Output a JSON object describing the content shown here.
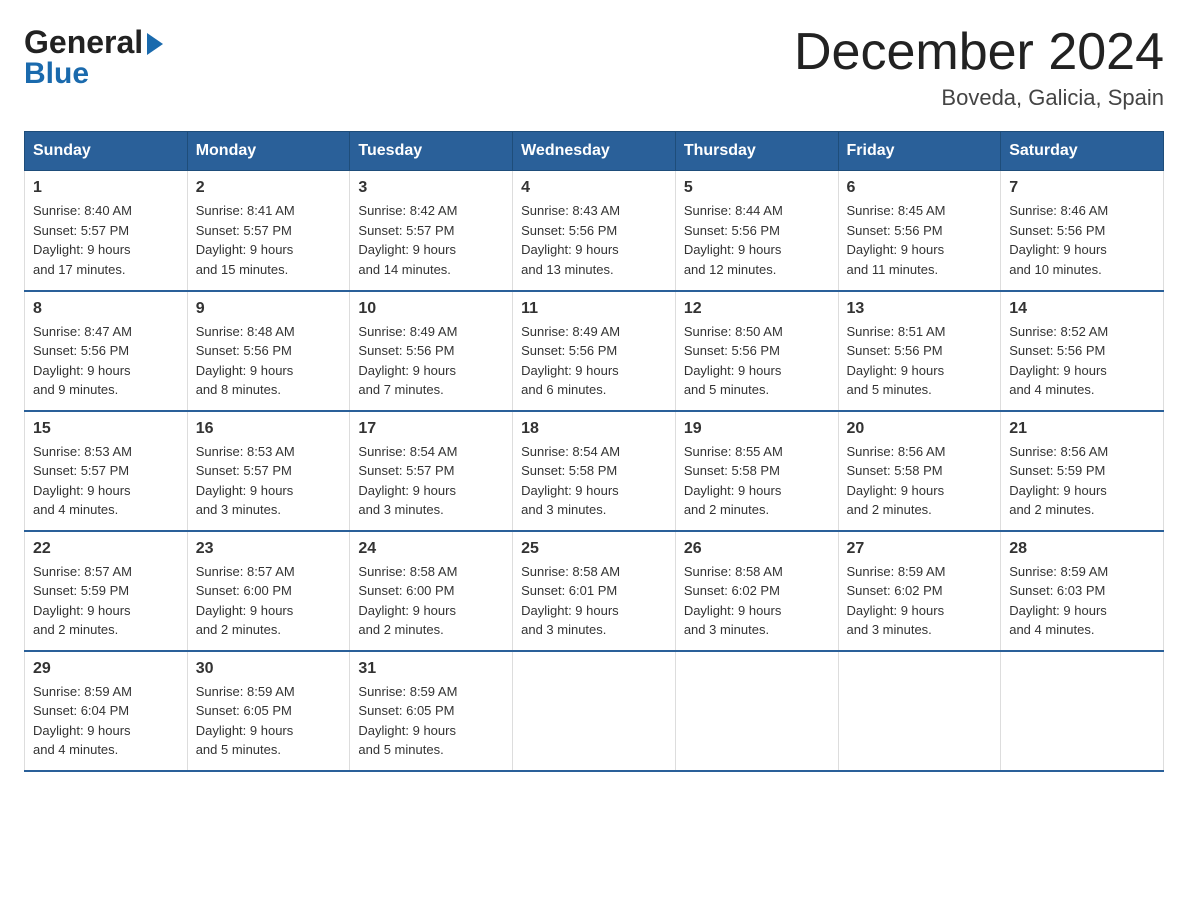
{
  "header": {
    "logo_line1": "General",
    "logo_line2": "Blue",
    "title": "December 2024",
    "location": "Boveda, Galicia, Spain"
  },
  "columns": [
    "Sunday",
    "Monday",
    "Tuesday",
    "Wednesday",
    "Thursday",
    "Friday",
    "Saturday"
  ],
  "weeks": [
    [
      {
        "day": "1",
        "sunrise": "8:40 AM",
        "sunset": "5:57 PM",
        "daylight": "9 hours and 17 minutes."
      },
      {
        "day": "2",
        "sunrise": "8:41 AM",
        "sunset": "5:57 PM",
        "daylight": "9 hours and 15 minutes."
      },
      {
        "day": "3",
        "sunrise": "8:42 AM",
        "sunset": "5:57 PM",
        "daylight": "9 hours and 14 minutes."
      },
      {
        "day": "4",
        "sunrise": "8:43 AM",
        "sunset": "5:56 PM",
        "daylight": "9 hours and 13 minutes."
      },
      {
        "day": "5",
        "sunrise": "8:44 AM",
        "sunset": "5:56 PM",
        "daylight": "9 hours and 12 minutes."
      },
      {
        "day": "6",
        "sunrise": "8:45 AM",
        "sunset": "5:56 PM",
        "daylight": "9 hours and 11 minutes."
      },
      {
        "day": "7",
        "sunrise": "8:46 AM",
        "sunset": "5:56 PM",
        "daylight": "9 hours and 10 minutes."
      }
    ],
    [
      {
        "day": "8",
        "sunrise": "8:47 AM",
        "sunset": "5:56 PM",
        "daylight": "9 hours and 9 minutes."
      },
      {
        "day": "9",
        "sunrise": "8:48 AM",
        "sunset": "5:56 PM",
        "daylight": "9 hours and 8 minutes."
      },
      {
        "day": "10",
        "sunrise": "8:49 AM",
        "sunset": "5:56 PM",
        "daylight": "9 hours and 7 minutes."
      },
      {
        "day": "11",
        "sunrise": "8:49 AM",
        "sunset": "5:56 PM",
        "daylight": "9 hours and 6 minutes."
      },
      {
        "day": "12",
        "sunrise": "8:50 AM",
        "sunset": "5:56 PM",
        "daylight": "9 hours and 5 minutes."
      },
      {
        "day": "13",
        "sunrise": "8:51 AM",
        "sunset": "5:56 PM",
        "daylight": "9 hours and 5 minutes."
      },
      {
        "day": "14",
        "sunrise": "8:52 AM",
        "sunset": "5:56 PM",
        "daylight": "9 hours and 4 minutes."
      }
    ],
    [
      {
        "day": "15",
        "sunrise": "8:53 AM",
        "sunset": "5:57 PM",
        "daylight": "9 hours and 4 minutes."
      },
      {
        "day": "16",
        "sunrise": "8:53 AM",
        "sunset": "5:57 PM",
        "daylight": "9 hours and 3 minutes."
      },
      {
        "day": "17",
        "sunrise": "8:54 AM",
        "sunset": "5:57 PM",
        "daylight": "9 hours and 3 minutes."
      },
      {
        "day": "18",
        "sunrise": "8:54 AM",
        "sunset": "5:58 PM",
        "daylight": "9 hours and 3 minutes."
      },
      {
        "day": "19",
        "sunrise": "8:55 AM",
        "sunset": "5:58 PM",
        "daylight": "9 hours and 2 minutes."
      },
      {
        "day": "20",
        "sunrise": "8:56 AM",
        "sunset": "5:58 PM",
        "daylight": "9 hours and 2 minutes."
      },
      {
        "day": "21",
        "sunrise": "8:56 AM",
        "sunset": "5:59 PM",
        "daylight": "9 hours and 2 minutes."
      }
    ],
    [
      {
        "day": "22",
        "sunrise": "8:57 AM",
        "sunset": "5:59 PM",
        "daylight": "9 hours and 2 minutes."
      },
      {
        "day": "23",
        "sunrise": "8:57 AM",
        "sunset": "6:00 PM",
        "daylight": "9 hours and 2 minutes."
      },
      {
        "day": "24",
        "sunrise": "8:58 AM",
        "sunset": "6:00 PM",
        "daylight": "9 hours and 2 minutes."
      },
      {
        "day": "25",
        "sunrise": "8:58 AM",
        "sunset": "6:01 PM",
        "daylight": "9 hours and 3 minutes."
      },
      {
        "day": "26",
        "sunrise": "8:58 AM",
        "sunset": "6:02 PM",
        "daylight": "9 hours and 3 minutes."
      },
      {
        "day": "27",
        "sunrise": "8:59 AM",
        "sunset": "6:02 PM",
        "daylight": "9 hours and 3 minutes."
      },
      {
        "day": "28",
        "sunrise": "8:59 AM",
        "sunset": "6:03 PM",
        "daylight": "9 hours and 4 minutes."
      }
    ],
    [
      {
        "day": "29",
        "sunrise": "8:59 AM",
        "sunset": "6:04 PM",
        "daylight": "9 hours and 4 minutes."
      },
      {
        "day": "30",
        "sunrise": "8:59 AM",
        "sunset": "6:05 PM",
        "daylight": "9 hours and 5 minutes."
      },
      {
        "day": "31",
        "sunrise": "8:59 AM",
        "sunset": "6:05 PM",
        "daylight": "9 hours and 5 minutes."
      },
      null,
      null,
      null,
      null
    ]
  ],
  "labels": {
    "sunrise": "Sunrise:",
    "sunset": "Sunset:",
    "daylight": "Daylight:"
  }
}
